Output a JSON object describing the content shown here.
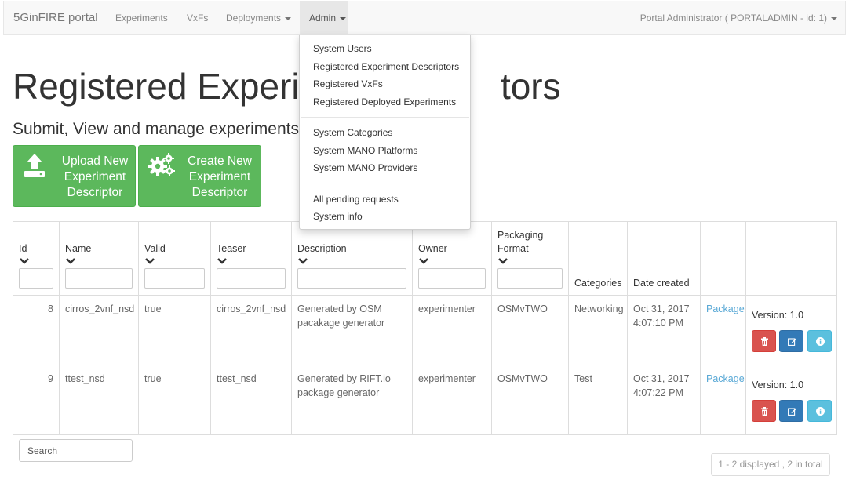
{
  "navbar": {
    "brand": "5GinFIRE portal",
    "links": [
      "Experiments",
      "VxFs",
      "Deployments",
      "Admin"
    ],
    "user": "Portal Administrator ( PORTALADMIN - id: 1)"
  },
  "page": {
    "title_visible": "Registered Experim",
    "title_tail": "tors",
    "subtitle_visible": "Submit, View and manage experiments c"
  },
  "buttons": {
    "upload": "Upload New Experiment Descriptor",
    "create": "Create New Experiment Descriptor"
  },
  "table": {
    "headers": {
      "id": "Id",
      "name": "Name",
      "valid": "Valid",
      "teaser": "Teaser",
      "description": "Description",
      "owner": "Owner",
      "packaging": "Packaging Format",
      "categories": "Categories",
      "date_created": "Date created"
    },
    "rows": [
      {
        "id": "8",
        "name": "cirros_2vnf_nsd",
        "valid": "true",
        "teaser": "cirros_2vnf_nsd",
        "description": "Generated by OSM pacakage generator",
        "owner": "experimenter",
        "packaging": "OSMvTWO",
        "category": "Networking",
        "date": "Oct 31, 2017 4:07:10 PM",
        "package_link": "Package",
        "version": "Version: 1.0"
      },
      {
        "id": "9",
        "name": "ttest_nsd",
        "valid": "true",
        "teaser": "ttest_nsd",
        "description": "Generated by RIFT.io package generator",
        "owner": "experimenter",
        "packaging": "OSMvTWO",
        "category": "Test",
        "date": "Oct 31, 2017 4:07:22 PM",
        "package_link": "Package",
        "version": "Version: 1.0"
      }
    ]
  },
  "search": {
    "placeholder": "Search"
  },
  "pager": {
    "info": "1 - 2 displayed , 2 in total"
  },
  "admin_menu": {
    "group1": [
      "System Users",
      "Registered Experiment Descriptors",
      "Registered VxFs",
      "Registered Deployed Experiments"
    ],
    "group2": [
      "System Categories",
      "System MANO Platforms",
      "System MANO Providers"
    ],
    "group3": [
      "All pending requests",
      "System info"
    ]
  },
  "colors": {
    "success": "#5cb85c",
    "danger": "#d9534f",
    "primary": "#337ab7",
    "info": "#5bc0de",
    "link": "#5aa9d6"
  },
  "icons": [
    "upload-icon",
    "gears-icon",
    "chevron-down-icon",
    "trash-icon",
    "edit-icon",
    "info-icon",
    "caret-down-icon"
  ]
}
